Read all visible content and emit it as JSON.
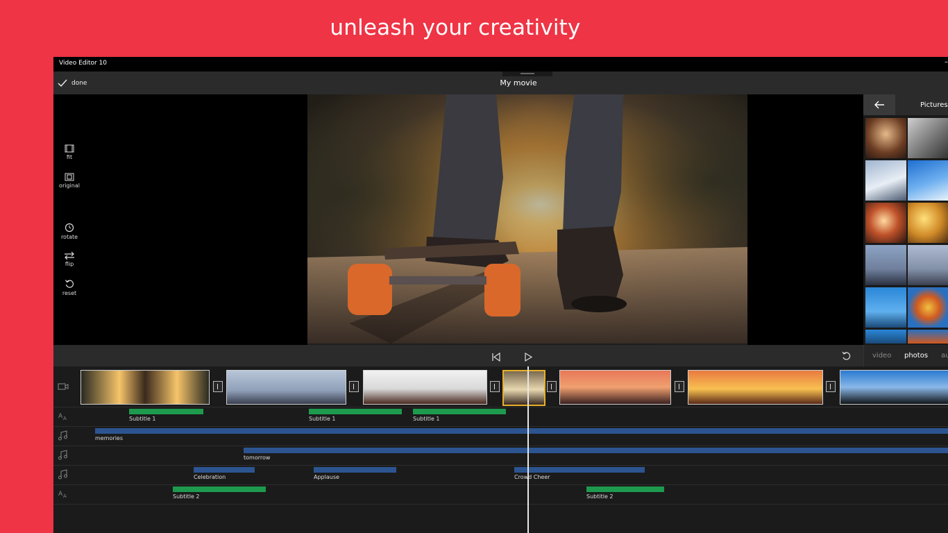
{
  "banner": {
    "tagline": "unleash your creativity"
  },
  "window": {
    "app_title": "Video Editor 10"
  },
  "topbar": {
    "done_label": "done",
    "project_title": "My movie"
  },
  "tools": {
    "fit": "fit",
    "original": "original",
    "rotate": "rotate",
    "flip": "flip",
    "reset": "reset"
  },
  "side_panel": {
    "title": "Pictures",
    "tabs": [
      "video",
      "photos",
      "au"
    ],
    "active_tab": "photos"
  },
  "controls": {
    "skip_back": "skip-back",
    "play": "play",
    "undo": "undo"
  },
  "timeline": {
    "subtitle_row_1": [
      {
        "label": "Subtitle 1"
      },
      {
        "label": "Subtitle 1"
      },
      {
        "label": "Subtitle 1"
      }
    ],
    "music_row_1": [
      {
        "label": "memories"
      }
    ],
    "music_row_2": [
      {
        "label": "tomorrow"
      }
    ],
    "sfx_row": [
      {
        "label": "Celebration"
      },
      {
        "label": "Applause"
      },
      {
        "label": "Crowd Cheer"
      }
    ],
    "subtitle_row_2": [
      {
        "label": "Subtitle 2"
      },
      {
        "label": "Subtitle 2"
      }
    ]
  },
  "colors": {
    "background": "#ee3445",
    "subtitle_bar": "#1d9a4e",
    "audio_bar": "#2c5490",
    "selected_clip": "#e8b02a"
  }
}
